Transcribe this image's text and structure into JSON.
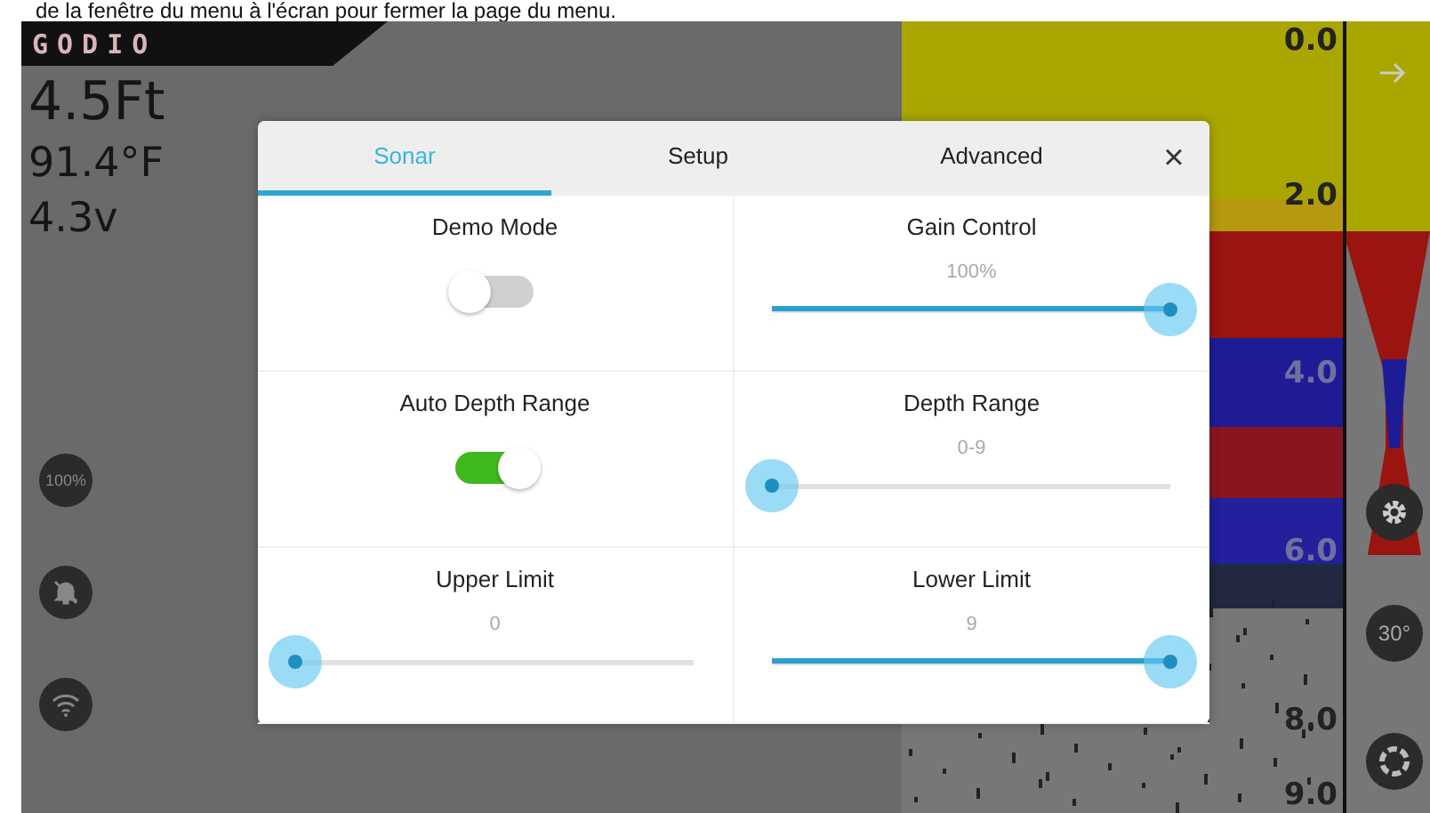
{
  "caption": "de la fenêtre du menu à l'écran pour fermer la page du menu.",
  "logo": "GODIO",
  "readings": [
    "4.5Ft",
    "91.4°F",
    "4.3v"
  ],
  "side_buttons": [
    {
      "kind": "text",
      "label": "100%"
    },
    {
      "kind": "bell-off"
    },
    {
      "kind": "wifi"
    }
  ],
  "depth_scale": [
    "0.0",
    "2.0",
    "4.0",
    "6.0",
    "8.0",
    "9.0"
  ],
  "right_buttons": [
    {
      "kind": "gear"
    },
    {
      "kind": "text",
      "label": "30°"
    },
    {
      "kind": "ring"
    }
  ],
  "dialog": {
    "tabs": [
      {
        "label": "Sonar",
        "selected": true
      },
      {
        "label": "Setup",
        "selected": false
      },
      {
        "label": "Advanced",
        "selected": false
      }
    ],
    "close": "×",
    "settings": [
      {
        "kind": "toggle",
        "label": "Demo Mode",
        "on": false
      },
      {
        "kind": "slider",
        "label": "Gain Control",
        "reading": "100%",
        "level": 1
      },
      {
        "kind": "toggle",
        "label": "Auto Depth Range",
        "on": true
      },
      {
        "kind": "slider",
        "label": "Depth Range",
        "reading": "0-9",
        "level": 0
      },
      {
        "kind": "slider",
        "label": "Upper Limit",
        "reading": "0",
        "level": 0
      },
      {
        "kind": "slider",
        "label": "Lower Limit",
        "reading": "9",
        "level": 1
      }
    ]
  }
}
